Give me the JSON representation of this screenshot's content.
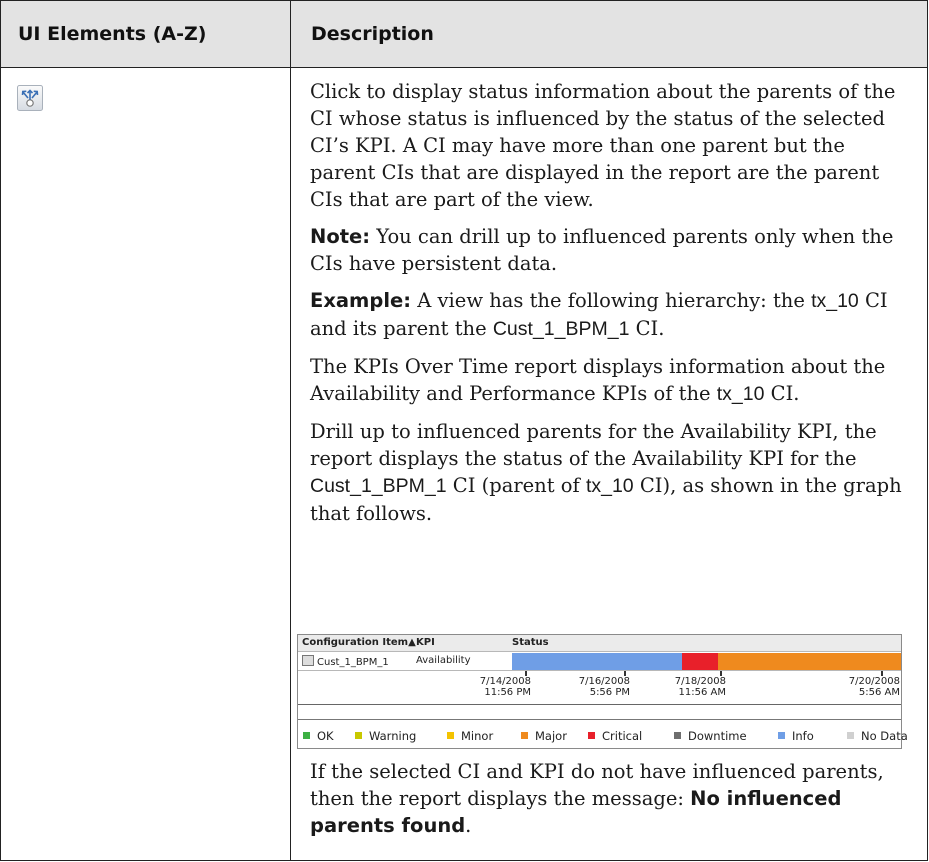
{
  "table": {
    "header": {
      "col1": "UI Elements (A-Z)",
      "col2": "Description"
    }
  },
  "row": {
    "icon": "drill-up-influenced-parents-icon",
    "paragraphs": {
      "p1": "Click to display status information about the parents of the CI whose status is influenced by the status of the selected CI’s KPI. A CI may have more than one parent but the parent CIs that are displayed in the report are the parent CIs that are part of the view.",
      "p2_label": "Note:",
      "p2_text": " You can drill up to influenced parents only when the CIs have persistent data.",
      "p3_label": "Example:",
      "p3_a": " A view has the following hierarchy: the ",
      "p3_code1": "tx_10",
      "p3_b": " CI and its parent the ",
      "p3_code2": "Cust_1_BPM_1",
      "p3_c": " CI.",
      "p4_a": "The KPIs Over Time report displays information about the Availability and Performance KPIs of the ",
      "p4_code": "tx_10",
      "p4_b": " CI.",
      "p5_a": "Drill up to influenced parents for the Availability KPI, the report displays the status of the Availability KPI for the ",
      "p5_code1": "Cust_1_BPM_1",
      "p5_b": " CI (parent of ",
      "p5_code2": "tx_10",
      "p5_c": " CI), as shown in the graph that follows.",
      "p6_a": "If the selected CI and KPI do not have influenced parents, then the report displays the message: ",
      "p6_bold": "No influenced parents found",
      "p6_b": "."
    }
  },
  "graph": {
    "headers": {
      "ci": "Configuration Item▲",
      "kpi": "KPI",
      "status": "Status"
    },
    "ci_name": "Cust_1_BPM_1",
    "kpi_name": "Availability",
    "ticks": [
      {
        "date": "7/14/2008",
        "time": "11:56 PM"
      },
      {
        "date": "7/16/2008",
        "time": "5:56 PM"
      },
      {
        "date": "7/18/2008",
        "time": "11:56 AM"
      },
      {
        "date": "7/20/2008",
        "time": "5:56 AM"
      }
    ],
    "segments": [
      {
        "status": "Info",
        "fraction": 0.437
      },
      {
        "status": "Critical",
        "fraction": 0.093
      },
      {
        "status": "Major",
        "fraction": 0.47
      }
    ],
    "legend": [
      {
        "label": "OK",
        "color": "#3cb043"
      },
      {
        "label": "Warning",
        "color": "#c8c800"
      },
      {
        "label": "Minor",
        "color": "#f4c300"
      },
      {
        "label": "Major",
        "color": "#ef8a1e"
      },
      {
        "label": "Critical",
        "color": "#e8202a"
      },
      {
        "label": "Downtime",
        "color": "#6e6e6e"
      },
      {
        "label": "Info",
        "color": "#6f9ee6"
      },
      {
        "label": "No Data",
        "color": "#d0d0d0"
      }
    ]
  }
}
